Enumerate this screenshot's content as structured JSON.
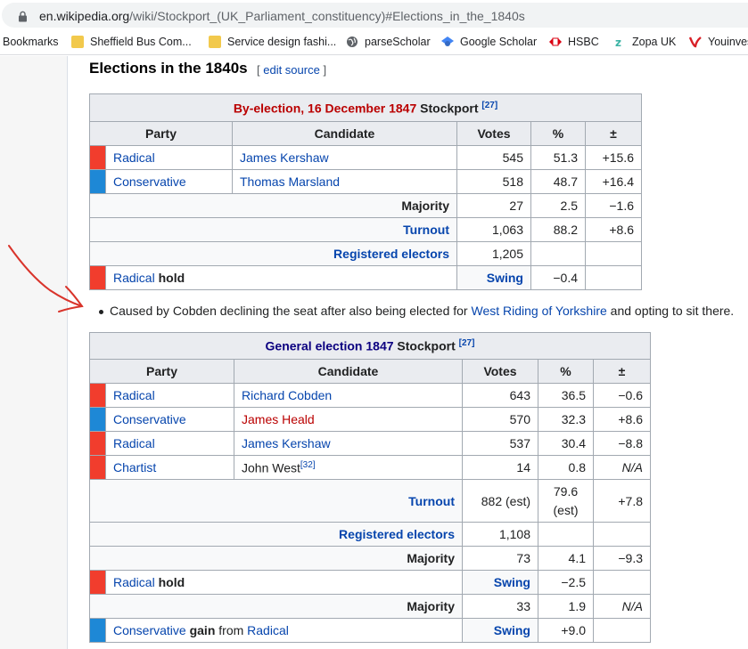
{
  "browser": {
    "url_host": "en.wikipedia.org",
    "url_path": "/wiki/Stockport_(UK_Parliament_constituency)#Elections_in_the_1840s",
    "bookmarks": [
      {
        "label": "Bookmarks",
        "icon": "none"
      },
      {
        "label": "Sheffield Bus Com...",
        "icon": "folder-icon"
      },
      {
        "label": "Service design fashi...",
        "icon": "folder-icon"
      },
      {
        "label": "parseScholar",
        "icon": "globe-icon"
      },
      {
        "label": "Google Scholar",
        "icon": "scholar-icon"
      },
      {
        "label": "HSBC",
        "icon": "hsbc-icon"
      },
      {
        "label": "Zopa UK",
        "icon": "zopa-icon"
      },
      {
        "label": "Youinves",
        "icon": "youinvest-icon"
      }
    ]
  },
  "section": {
    "title": "Elections in the 1840s",
    "edit_open": "[ ",
    "edit_label": "edit source",
    "edit_close": " ]"
  },
  "colors": {
    "radical": "#f13d2d",
    "conservative": "#1e88d6",
    "chartist": "#f13d2d",
    "link": "#0645ad",
    "redlink": "#ba0000"
  },
  "byelection": {
    "caption_link": "By-election, 16 December 1847",
    "caption_rest": " Stockport ",
    "caption_ref": "[27]",
    "headers": {
      "party": "Party",
      "candidate": "Candidate",
      "votes": "Votes",
      "pct": "%",
      "change": "±"
    },
    "rows": [
      {
        "party": "Radical",
        "candidate": "James Kershaw",
        "votes": "545",
        "pct": "51.3",
        "change": "+15.6"
      },
      {
        "party": "Conservative",
        "candidate": "Thomas Marsland",
        "votes": "518",
        "pct": "48.7",
        "change": "+16.4"
      }
    ],
    "majority": {
      "label": "Majority",
      "votes": "27",
      "pct": "2.5",
      "change": "−1.6"
    },
    "turnout": {
      "label": "Turnout",
      "votes": "1,063",
      "pct": "88.2",
      "change": "+8.6"
    },
    "electors": {
      "label": "Registered electors",
      "votes": "1,205"
    },
    "hold": {
      "party": "Radical",
      "word": "hold",
      "swing_label": "Swing",
      "swing": "−0.4"
    }
  },
  "note": {
    "before": "Caused by Cobden declining the seat after also being elected for ",
    "link": "West Riding of Yorkshire",
    "after": " and opting to sit there."
  },
  "general": {
    "caption_link": "General election 1847",
    "caption_rest": " Stockport ",
    "caption_ref": "[27]",
    "headers": {
      "party": "Party",
      "candidate": "Candidate",
      "votes": "Votes",
      "pct": "%",
      "change": "±"
    },
    "rows": [
      {
        "party": "Radical",
        "candidate": "Richard Cobden",
        "votes": "643",
        "pct": "36.5",
        "change": "−0.6"
      },
      {
        "party": "Conservative",
        "candidate": "James Heald",
        "votes": "570",
        "pct": "32.3",
        "change": "+8.6"
      },
      {
        "party": "Radical",
        "candidate": "James Kershaw",
        "votes": "537",
        "pct": "30.4",
        "change": "−8.8"
      },
      {
        "party": "Chartist",
        "candidate": "John West",
        "candidate_ref": "[32]",
        "votes": "14",
        "pct": "0.8",
        "change": "N/A"
      }
    ],
    "turnout": {
      "label": "Turnout",
      "votes": "882 (est)",
      "pct_line1": "79.6",
      "pct_line2": "(est)",
      "change": "+7.8"
    },
    "electors": {
      "label": "Registered electors",
      "votes": "1,108"
    },
    "majority1": {
      "label": "Majority",
      "votes": "73",
      "pct": "4.1",
      "change": "−9.3"
    },
    "hold": {
      "party": "Radical",
      "word": "hold",
      "swing_label": "Swing",
      "swing": "−2.5"
    },
    "majority2": {
      "label": "Majority",
      "votes": "33",
      "pct": "1.9",
      "change": "N/A"
    },
    "gain": {
      "party": "Conservative",
      "word": "gain",
      "from": " from ",
      "from_party": "Radical",
      "swing_label": "Swing",
      "swing": "+9.0"
    }
  }
}
